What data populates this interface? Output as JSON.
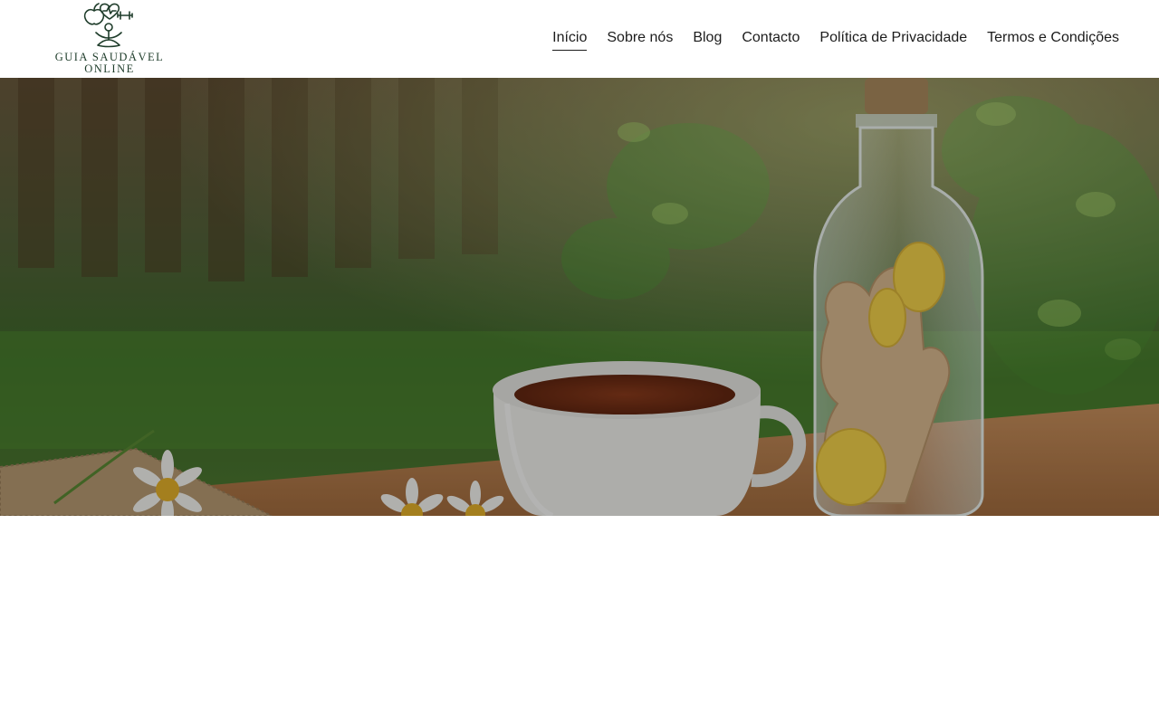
{
  "header": {
    "logo": {
      "line1": "GUIA SAUDÁVEL",
      "line2": "ONLINE",
      "icon": "healthy-lifestyle-logo-icon",
      "color": "#1f3d2b"
    },
    "nav": [
      {
        "label": "Início",
        "active": true
      },
      {
        "label": "Sobre nós",
        "active": false
      },
      {
        "label": "Blog",
        "active": false
      },
      {
        "label": "Contacto",
        "active": false
      },
      {
        "label": "Política de Privacidade",
        "active": false
      },
      {
        "label": "Termos e Condições",
        "active": false
      }
    ]
  },
  "hero": {
    "image": "tea-cup-and-ginger-bottle-photo",
    "overlay_color": "#000000"
  }
}
